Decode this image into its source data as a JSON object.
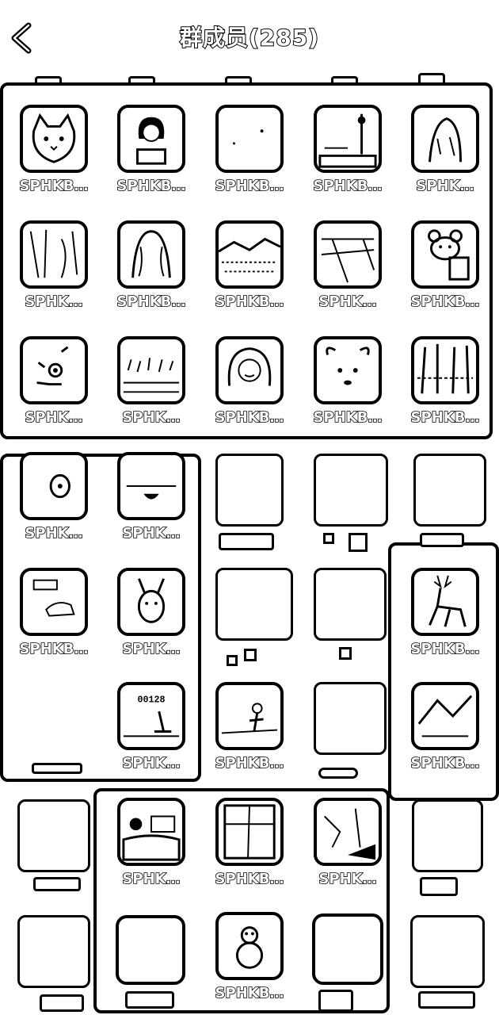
{
  "header": {
    "title": "群成员(285)",
    "back_icon": "chevron-left-icon"
  },
  "members": [
    {
      "name": "SPHKB…",
      "avatar": "cat"
    },
    {
      "name": "SPHKB…",
      "avatar": "girl-reading"
    },
    {
      "name": "SPHKB…",
      "avatar": "blank-white"
    },
    {
      "name": "SPHKB…",
      "avatar": "harbor"
    },
    {
      "name": "SPHK…",
      "avatar": "woman-sketch"
    },
    {
      "name": "SPHK…",
      "avatar": "sketch-figure"
    },
    {
      "name": "SPHKB…",
      "avatar": "wavy-hair"
    },
    {
      "name": "SPHKB…",
      "avatar": "landscape"
    },
    {
      "name": "SPHK…",
      "avatar": "court"
    },
    {
      "name": "SPHKB…",
      "avatar": "bear-cartoon"
    },
    {
      "name": "SPHK…",
      "avatar": "doodle-face"
    },
    {
      "name": "SPHK…",
      "avatar": "grass-field"
    },
    {
      "name": "SPHKB…",
      "avatar": "girl-smiling"
    },
    {
      "name": "SPHKB…",
      "avatar": "white-dog"
    },
    {
      "name": "SPHKB…",
      "avatar": "forest"
    },
    {
      "name": "SPHK…",
      "avatar": "glitch-egg"
    },
    {
      "name": "SPHK…",
      "avatar": "glitch-smile"
    },
    {
      "name": "SPHKB…",
      "avatar": "sketch-animal"
    },
    {
      "name": "SPHK…",
      "avatar": "kangaroo"
    },
    {
      "name": "SPHKB…",
      "avatar": "deer"
    },
    {
      "name": "SPHK…",
      "avatar": "counter-display"
    },
    {
      "name": "SPHKB…",
      "avatar": "person-field"
    },
    {
      "name": "SPHKB…",
      "avatar": "mountain-scene"
    },
    {
      "name": "SPHK…",
      "avatar": "dog-lake"
    },
    {
      "name": "SPHKB…",
      "avatar": "window-frame"
    },
    {
      "name": "SPHK…",
      "avatar": "sea-cliff"
    },
    {
      "name": "SPHKB…",
      "avatar": "snowman"
    }
  ],
  "counter_text": "00128"
}
